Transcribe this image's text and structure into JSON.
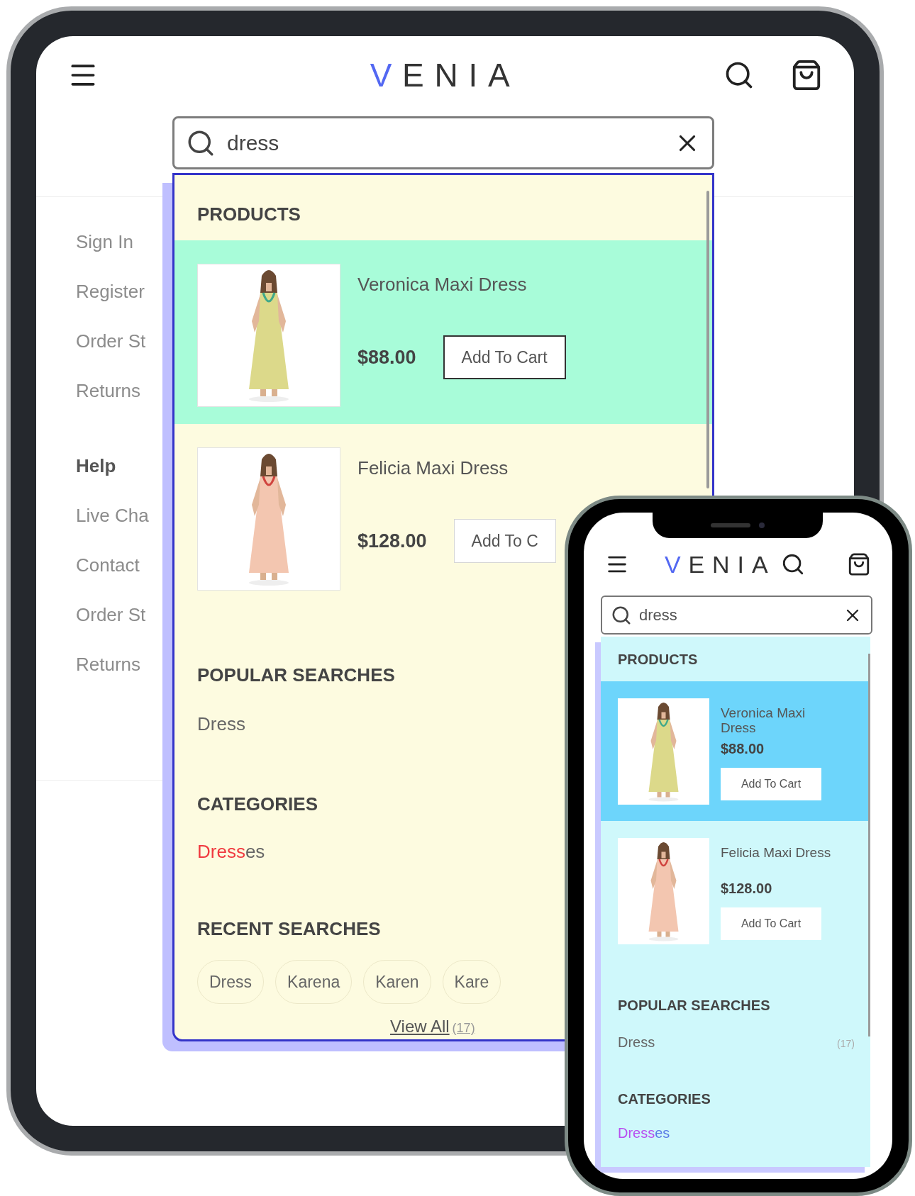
{
  "tablet": {
    "logo": {
      "accent": "V",
      "rest": "ENIA"
    },
    "search": {
      "value": "dress"
    },
    "sidebar": [
      {
        "items": [
          "Sign In",
          "Register",
          "Order St",
          "Returns"
        ]
      },
      {
        "title": "Help",
        "items": [
          "Live Cha",
          "Contact",
          "Order St",
          "Returns"
        ]
      }
    ],
    "dropdown": {
      "products_heading": "PRODUCTS",
      "products": [
        {
          "name": "Veronica Maxi Dress",
          "price": "$88.00",
          "button": "Add To Cart",
          "selected": true
        },
        {
          "name": "Felicia Maxi Dress",
          "price": "$128.00",
          "button": "Add To C",
          "selected": false
        }
      ],
      "popular_heading": "POPULAR SEARCHES",
      "popular": [
        {
          "term": "Dress"
        }
      ],
      "categories_heading": "CATEGORIES",
      "categories": [
        {
          "match": "Dress",
          "rest": "es"
        }
      ],
      "recent_heading": "RECENT SEARCHES",
      "recent": [
        "Dress",
        "Karena",
        "Karen",
        "Kare"
      ],
      "view_all": {
        "label": "View All",
        "count": "(17)"
      }
    }
  },
  "phone": {
    "logo": {
      "accent": "V",
      "rest": "ENIA"
    },
    "search": {
      "value": "dress"
    },
    "dropdown": {
      "products_heading": "PRODUCTS",
      "products": [
        {
          "name": "Veronica Maxi Dress",
          "price": "$88.00",
          "button": "Add To Cart",
          "selected": true
        },
        {
          "name": "Felicia Maxi Dress",
          "price": "$128.00",
          "button": "Add To Cart",
          "selected": false
        }
      ],
      "popular_heading": "POPULAR SEARCHES",
      "popular": [
        {
          "term": "Dress",
          "count": "(17)"
        }
      ],
      "categories_heading": "CATEGORIES",
      "categories": [
        {
          "match": "Dress",
          "rest": "es"
        }
      ]
    }
  }
}
